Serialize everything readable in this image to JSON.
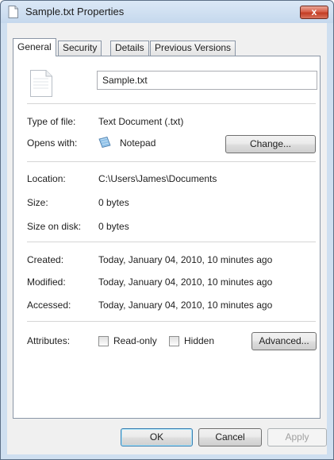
{
  "window": {
    "title": "Sample.txt Properties",
    "close_label": "x"
  },
  "tabs": [
    {
      "label": "General",
      "active": true
    },
    {
      "label": "Security",
      "active": false
    },
    {
      "label": "Details",
      "active": false
    },
    {
      "label": "Previous Versions",
      "active": false
    }
  ],
  "general": {
    "file_name": "Sample.txt",
    "type_label": "Type of file:",
    "type_value": "Text Document (.txt)",
    "opens_label": "Opens with:",
    "opens_value": "Notepad",
    "change_button": "Change...",
    "location_label": "Location:",
    "location_value": "C:\\Users\\James\\Documents",
    "size_label": "Size:",
    "size_value": "0 bytes",
    "size_on_disk_label": "Size on disk:",
    "size_on_disk_value": "0 bytes",
    "created_label": "Created:",
    "created_value": "Today, January 04, 2010, 10 minutes ago",
    "modified_label": "Modified:",
    "modified_value": "Today, January 04, 2010, 10 minutes ago",
    "accessed_label": "Accessed:",
    "accessed_value": "Today, January 04, 2010, 10 minutes ago",
    "attributes_label": "Attributes:",
    "readonly_label": "Read-only",
    "readonly_checked": false,
    "hidden_label": "Hidden",
    "hidden_checked": false,
    "advanced_button": "Advanced..."
  },
  "footer": {
    "ok": "OK",
    "cancel": "Cancel",
    "apply": "Apply"
  },
  "colors": {
    "close_button": "#c33d24",
    "window_frame": "#cfdff0",
    "panel_bg": "#ffffff"
  },
  "icons": {
    "title": "text-file-icon",
    "file": "text-file-icon",
    "opens_with": "notepad-icon"
  }
}
